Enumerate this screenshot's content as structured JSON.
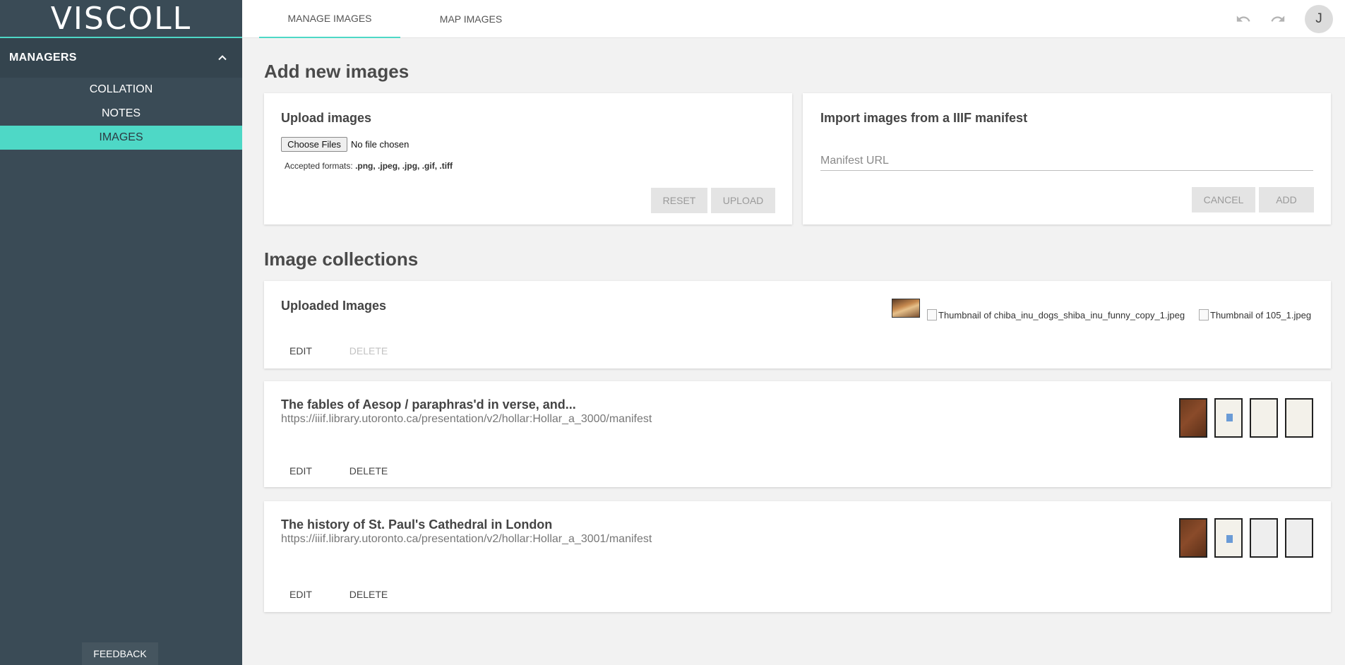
{
  "logo": "VISCOLL",
  "sidebar": {
    "section_title": "MANAGERS",
    "items": [
      {
        "label": "COLLATION"
      },
      {
        "label": "NOTES"
      },
      {
        "label": "IMAGES"
      }
    ],
    "feedback_label": "FEEDBACK"
  },
  "topbar": {
    "tabs": [
      {
        "label": "MANAGE IMAGES"
      },
      {
        "label": "MAP IMAGES"
      }
    ],
    "avatar_initial": "J"
  },
  "add_section": {
    "heading": "Add new images",
    "upload": {
      "title": "Upload images",
      "choose_label": "Choose Files",
      "no_file": "No file chosen",
      "formats_prefix": "Accepted formats:",
      "formats": ".png, .jpeg, .jpg, .gif, .tiff",
      "reset_label": "RESET",
      "upload_label": "UPLOAD"
    },
    "import": {
      "title": "Import images from a IIIF manifest",
      "placeholder": "Manifest URL",
      "cancel_label": "CANCEL",
      "add_label": "ADD"
    }
  },
  "collections": {
    "heading": "Image collections",
    "uploaded": {
      "title": "Uploaded Images",
      "broken_thumbs": [
        "Thumbnail of chiba_inu_dogs_shiba_inu_funny_copy_1.jpeg",
        "Thumbnail of 105_1.jpeg"
      ],
      "edit_label": "EDIT",
      "delete_label": "DELETE"
    },
    "items": [
      {
        "title": "The fables of Aesop / paraphras'd in verse, and...",
        "url": "https://iiif.library.utoronto.ca/presentation/v2/hollar:Hollar_a_3000/manifest",
        "edit_label": "EDIT",
        "delete_label": "DELETE"
      },
      {
        "title": "The history of St. Paul's Cathedral in London",
        "url": "https://iiif.library.utoronto.ca/presentation/v2/hollar:Hollar_a_3001/manifest",
        "edit_label": "EDIT",
        "delete_label": "DELETE"
      }
    ]
  },
  "colors": {
    "accent": "#4ed8c6",
    "sidebar_bg": "#3a4b56",
    "page_bg": "#f2f2f2"
  }
}
